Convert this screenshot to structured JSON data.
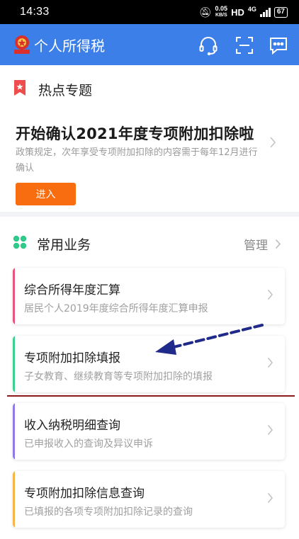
{
  "status_bar": {
    "time": "14:33",
    "speed_value": "0.05",
    "speed_unit": "KB/S",
    "hd": "HD",
    "network": "4G",
    "battery": "67"
  },
  "app_bar": {
    "title": "个人所得税",
    "icons": [
      "headset-icon",
      "scan-icon",
      "message-icon"
    ]
  },
  "hot_topic": {
    "section_title": "热点专题",
    "headline": "开始确认2021年度专项附加扣除啦",
    "description": "政策规定，次年享受专项附加扣除的内容需于每年12月进行确认",
    "button_label": "进入"
  },
  "common_services": {
    "section_title": "常用业务",
    "manage_label": "管理",
    "items": [
      {
        "title": "综合所得年度汇算",
        "subtitle": "居民个人2019年度综合所得年度汇算申报",
        "accent": "#e8547b"
      },
      {
        "title": "专项附加扣除填报",
        "subtitle": "子女教育、继续教育等专项附加扣除的填报",
        "accent": "#3ccf8e"
      },
      {
        "title": "收入纳税明细查询",
        "subtitle": "已申报收入的查询及异议申诉",
        "accent": "#8f7ae6"
      },
      {
        "title": "专项附加扣除信息查询",
        "subtitle": "已填报的各项专项附加扣除记录的查询",
        "accent": "#f5b54a"
      }
    ]
  },
  "colors": {
    "primary": "#3d7fe8",
    "button": "#f76d10",
    "annotation_arrow": "#1f2a8a",
    "annotation_line": "#8b1a1a"
  }
}
